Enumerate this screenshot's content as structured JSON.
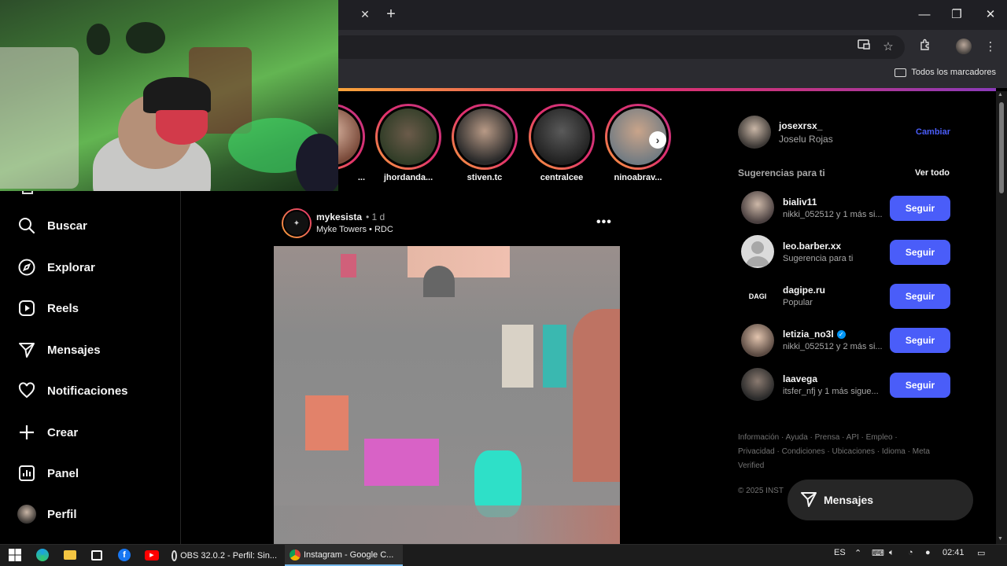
{
  "browser": {
    "tab_close": "✕",
    "new_tab": "+",
    "window": {
      "minimize": "—",
      "maximize": "❐",
      "close": "✕"
    },
    "bookmarks_all": "Todos los marcadores"
  },
  "sidebar": {
    "items": [
      {
        "label": "Buscar",
        "icon": "search-icon"
      },
      {
        "label": "Explorar",
        "icon": "compass-icon"
      },
      {
        "label": "Reels",
        "icon": "reels-icon"
      },
      {
        "label": "Mensajes",
        "icon": "send-icon"
      },
      {
        "label": "Notificaciones",
        "icon": "heart-icon"
      },
      {
        "label": "Crear",
        "icon": "plus-icon"
      },
      {
        "label": "Panel",
        "icon": "chart-icon"
      },
      {
        "label": "Perfil",
        "icon": "profile-avatar-icon"
      }
    ]
  },
  "stories": [
    {
      "name": "..."
    },
    {
      "name": "jhordanda..."
    },
    {
      "name": "stiven.tc"
    },
    {
      "name": "centralcee"
    },
    {
      "name": "ninoabrav..."
    }
  ],
  "post": {
    "username": "mykesista",
    "time": "• 1 d",
    "subtitle": "Myke Towers • RDC",
    "more": "•••"
  },
  "account": {
    "username": "josexrsx_",
    "name": "Joselu Rojas",
    "switch": "Cambiar"
  },
  "suggestions": {
    "title": "Sugerencias para ti",
    "see_all": "Ver todo",
    "follow_label": "Seguir",
    "items": [
      {
        "username": "bialiv11",
        "sub": "nikki_052512 y 1 más si...",
        "verified": false
      },
      {
        "username": "leo.barber.xx",
        "sub": "Sugerencia para ti",
        "verified": false
      },
      {
        "username": "dagipe.ru",
        "sub": "Popular",
        "verified": false,
        "avatar_text": "DAGI"
      },
      {
        "username": "letizia_no3l",
        "sub": "nikki_052512 y 2 más si...",
        "verified": true
      },
      {
        "username": "laavega",
        "sub": "itsfer_nfj y 1 más sigue...",
        "verified": false
      }
    ]
  },
  "footer": {
    "links": "Información · Ayuda · Prensa · API · Empleo · Privacidad · Condiciones · Ubicaciones · Idioma · Meta Verified",
    "copyright": "© 2025 INST"
  },
  "messages_pill": "Mensajes",
  "taskbar": {
    "apps": [
      {
        "label": "OBS 32.0.2 - Perfil: Sin..."
      },
      {
        "label": "Instagram - Google C..."
      }
    ],
    "lang": "ES",
    "time": "02:41"
  },
  "colors": {
    "accent_blue": "#4a5df9",
    "background": "#000000",
    "story_gradient": [
      "#f9a43a",
      "#e1306c",
      "#c13584"
    ]
  }
}
